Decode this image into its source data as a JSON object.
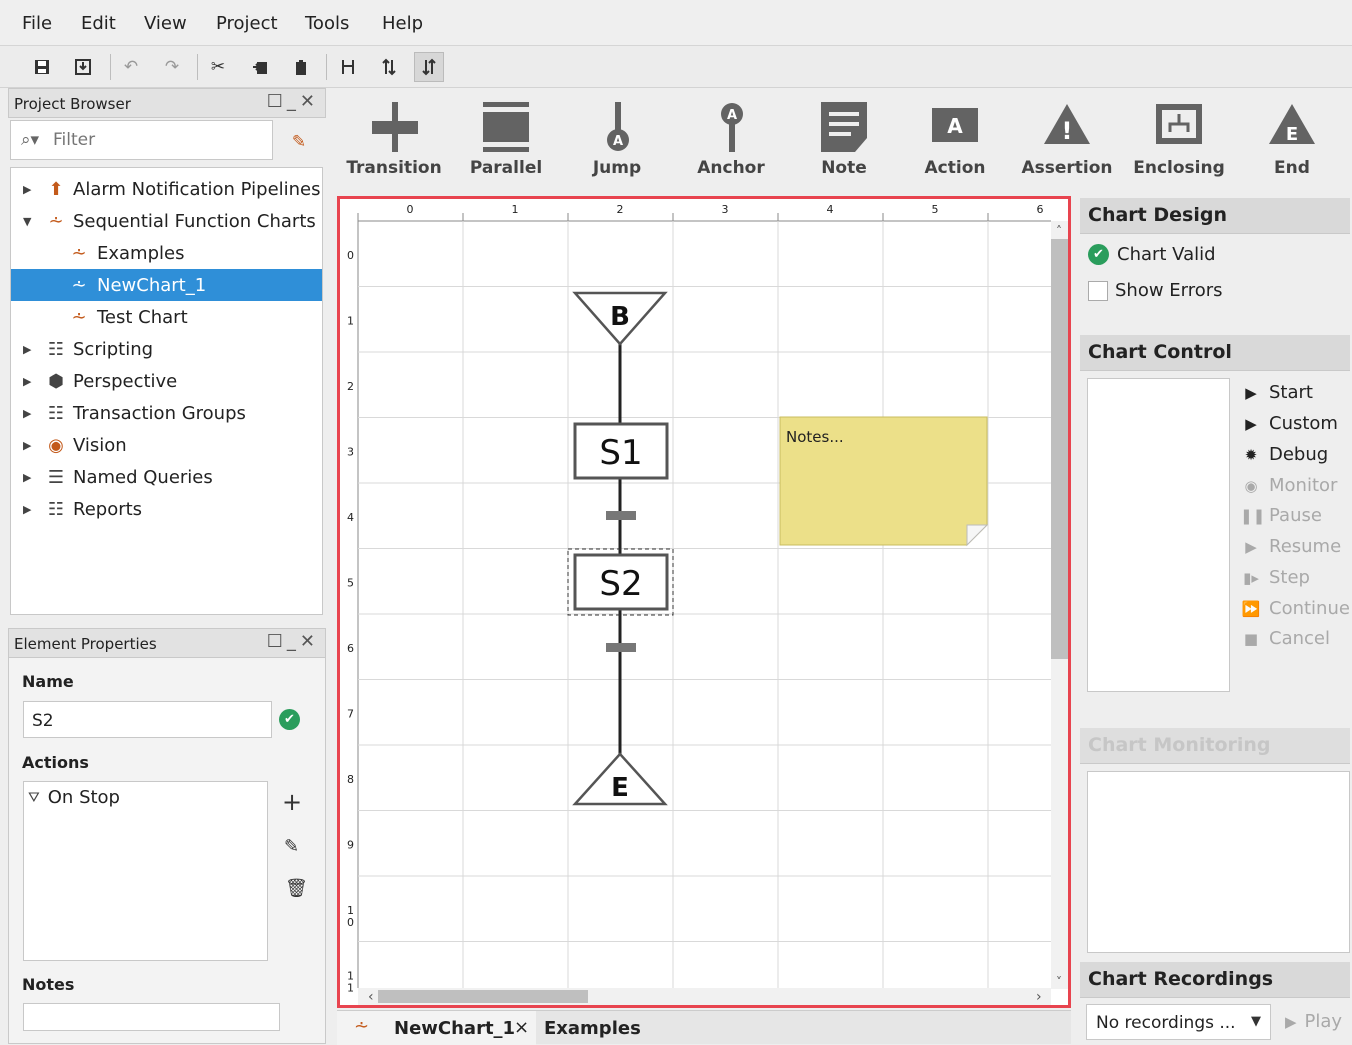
{
  "menu": [
    "File",
    "Edit",
    "View",
    "Project",
    "Tools",
    "Help"
  ],
  "project_browser": {
    "title": "Project Browser",
    "filter_placeholder": "Filter",
    "tree": [
      {
        "label": "Alarm Notification Pipelines",
        "icon": "alarm-pipeline-icon",
        "level": 0
      },
      {
        "label": "Sequential Function Charts",
        "icon": "sfc-icon",
        "level": 0
      },
      {
        "label": "Examples",
        "icon": "sfc-chart-icon",
        "level": 1
      },
      {
        "label": "NewChart_1",
        "icon": "sfc-chart-icon",
        "level": 1,
        "selected": true
      },
      {
        "label": "Test Chart",
        "icon": "sfc-chart-icon",
        "level": 1
      },
      {
        "label": "Scripting",
        "icon": "script-icon",
        "level": 0
      },
      {
        "label": "Perspective",
        "icon": "perspective-icon",
        "level": 0
      },
      {
        "label": "Transaction Groups",
        "icon": "transaction-groups-icon",
        "level": 0
      },
      {
        "label": "Vision",
        "icon": "vision-icon",
        "level": 0
      },
      {
        "label": "Named Queries",
        "icon": "named-queries-icon",
        "level": 0
      },
      {
        "label": "Reports",
        "icon": "reports-icon",
        "level": 0
      }
    ]
  },
  "element_properties": {
    "title": "Element Properties",
    "name_label": "Name",
    "name_value": "S2",
    "actions_label": "Actions",
    "actions": [
      "On Stop"
    ],
    "notes_label": "Notes",
    "notes_value": ""
  },
  "palette": [
    "Transition",
    "Parallel",
    "Jump",
    "Anchor",
    "Note",
    "Action",
    "Assertion",
    "Enclosing",
    "End"
  ],
  "palette_icon_letters": {
    "jump": "A",
    "anchor": "A",
    "action": "A",
    "assertion": "!",
    "end": "E"
  },
  "chart": {
    "col_labels": [
      "0",
      "1",
      "2",
      "3",
      "4",
      "5",
      "6"
    ],
    "row_labels": [
      "0",
      "1",
      "2",
      "3",
      "4",
      "5",
      "6",
      "7",
      "8",
      "9",
      "1\n0",
      "1\n1"
    ],
    "begin_label": "B",
    "end_label": "E",
    "steps": [
      "S1",
      "S2"
    ],
    "note_text": "Notes..."
  },
  "chart_design": {
    "title": "Chart Design",
    "valid_label": "Chart Valid",
    "show_errors_label": "Show Errors"
  },
  "chart_control": {
    "title": "Chart Control",
    "buttons": [
      {
        "label": "Start",
        "icon": "start-icon",
        "enabled": true
      },
      {
        "label": "Custom",
        "icon": "custom-icon",
        "enabled": true
      },
      {
        "label": "Debug",
        "icon": "debug-icon",
        "enabled": true
      },
      {
        "label": "Monitor",
        "icon": "monitor-icon",
        "enabled": false
      },
      {
        "label": "Pause",
        "icon": "pause-icon",
        "enabled": false
      },
      {
        "label": "Resume",
        "icon": "resume-icon",
        "enabled": false
      },
      {
        "label": "Step",
        "icon": "step-icon",
        "enabled": false
      },
      {
        "label": "Continue",
        "icon": "continue-icon",
        "enabled": false
      },
      {
        "label": "Cancel",
        "icon": "cancel-icon",
        "enabled": false
      }
    ]
  },
  "chart_monitoring": {
    "title": "Chart Monitoring"
  },
  "chart_recordings": {
    "title": "Chart Recordings",
    "select_value": "No recordings ...",
    "play_label": "Play"
  },
  "tabs": [
    {
      "label": "NewChart_1",
      "active": true,
      "close": "×"
    },
    {
      "label": "Examples",
      "active": false
    }
  ],
  "colors": {
    "selection": "#2f8fd8",
    "highlight_border": "#e8444f",
    "note_fill": "#ece089",
    "valid_green": "#2a9d5c"
  }
}
